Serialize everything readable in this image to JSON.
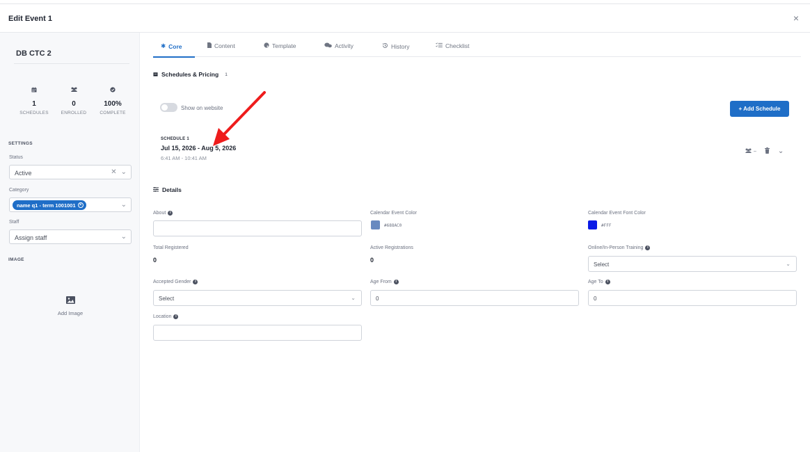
{
  "modal": {
    "title": "Edit Event 1",
    "close_label": "×"
  },
  "sidebar": {
    "event_name": "DB CTC 2",
    "stats": [
      {
        "value": "1",
        "label": "SCHEDULES",
        "icon": "calendar-icon"
      },
      {
        "value": "0",
        "label": "ENROLLED",
        "icon": "users-icon"
      },
      {
        "value": "100%",
        "label": "COMPLETE",
        "icon": "check-circle-icon"
      }
    ],
    "settings_title": "SETTINGS",
    "status": {
      "label": "Status",
      "value": "Active"
    },
    "category": {
      "label": "Category",
      "chip": "name q1 - term 1001001"
    },
    "staff": {
      "label": "Staff",
      "placeholder": "Assign staff"
    },
    "image_title": "IMAGE",
    "add_image_label": "Add Image"
  },
  "tabs": [
    {
      "label": "Core",
      "icon": "gear-icon",
      "active": true
    },
    {
      "label": "Content",
      "icon": "file-icon"
    },
    {
      "label": "Template",
      "icon": "palette-icon"
    },
    {
      "label": "Activity",
      "icon": "chat-icon"
    },
    {
      "label": "History",
      "icon": "history-icon"
    },
    {
      "label": "Checklist",
      "icon": "checklist-icon"
    }
  ],
  "schedules": {
    "title": "Schedules & Pricing",
    "count": "1",
    "toggle_label": "Show on website",
    "add_button": "+ Add Schedule",
    "items": [
      {
        "label": "SCHEDULE 1",
        "date": "Jul 15, 2026 - Aug 5, 2026",
        "time": "6:41 AM - 10:41 AM"
      }
    ]
  },
  "details": {
    "title": "Details",
    "about_label": "About",
    "calendar_color_label": "Calendar Event Color",
    "calendar_color": "#688AC0",
    "font_color_label": "Calendar Event Font Color",
    "font_color_text": "#FFF",
    "font_color_swatch": "#0a1be6",
    "total_registered_label": "Total Registered",
    "total_registered": "0",
    "active_registrations_label": "Active Registrations",
    "active_registrations": "0",
    "training_label": "Online/In-Person Training",
    "training_placeholder": "Select",
    "gender_label": "Accepted Gender",
    "gender_placeholder": "Select",
    "age_from_label": "Age From",
    "age_from": "0",
    "age_to_label": "Age To",
    "age_to": "0",
    "location_label": "Location"
  },
  "colors": {
    "accent": "#1f6ec7",
    "annotation_arrow": "#ee1c1c"
  }
}
